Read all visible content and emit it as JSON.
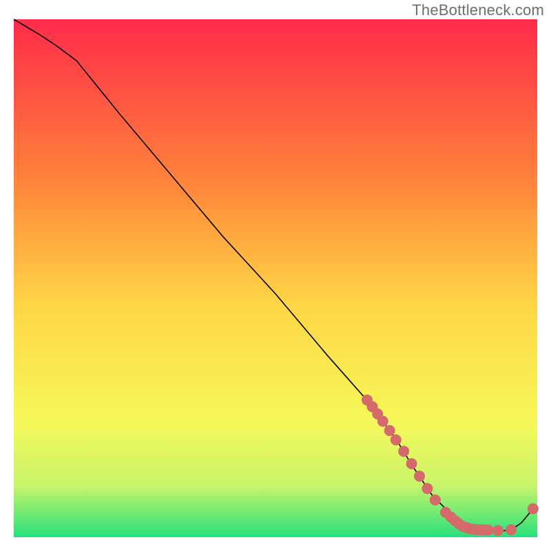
{
  "watermark": "TheBottleneck.com",
  "chart_data": {
    "type": "line",
    "title": "",
    "xlabel": "",
    "ylabel": "",
    "xlim": [
      0,
      100
    ],
    "ylim": [
      0,
      100
    ],
    "grid": false,
    "legend": false,
    "background_gradient": {
      "top_color": "#ff2b4a",
      "mid_upper": "#ff803b",
      "mid": "#ffd645",
      "mid_lower": "#f5f85a",
      "near_bottom": "#c8f56a",
      "bottom_color": "#27e07d"
    },
    "series": [
      {
        "name": "bottleneck-curve",
        "draw": "line",
        "color": "#000000",
        "stroke_width": 1.6,
        "x": [
          0,
          5,
          8,
          12,
          20,
          30,
          40,
          50,
          60,
          67,
          70,
          73,
          76,
          80,
          85,
          90,
          93,
          95,
          97,
          99.2
        ],
        "y": [
          100,
          97,
          95,
          92,
          82,
          70,
          58,
          47,
          35,
          27,
          23,
          19,
          14,
          8,
          3,
          1.5,
          1.2,
          1.4,
          2.8,
          5.5
        ]
      },
      {
        "name": "highlight-cluster-upper",
        "draw": "markers",
        "color": "#d46a6a",
        "marker_radius": 8,
        "x": [
          67.5,
          68.5,
          69.5,
          70.5,
          71.8,
          73.0,
          74.5,
          76.0,
          77.5,
          79.0,
          80.5
        ],
        "y": [
          26.5,
          25.2,
          23.8,
          22.4,
          20.6,
          18.8,
          16.6,
          14.2,
          11.8,
          9.4,
          7.2
        ]
      },
      {
        "name": "highlight-cluster-lower",
        "draw": "markers",
        "color": "#d46a6a",
        "marker_radius": 8,
        "x": [
          82.5,
          83.5,
          84.3,
          85.0,
          85.8,
          86.6,
          87.4,
          88.2,
          89.0,
          89.8,
          90.6,
          92.5,
          95.0,
          99.2
        ],
        "y": [
          4.8,
          3.9,
          3.2,
          2.6,
          2.1,
          1.8,
          1.6,
          1.5,
          1.45,
          1.42,
          1.4,
          1.3,
          1.45,
          5.5
        ]
      }
    ]
  }
}
